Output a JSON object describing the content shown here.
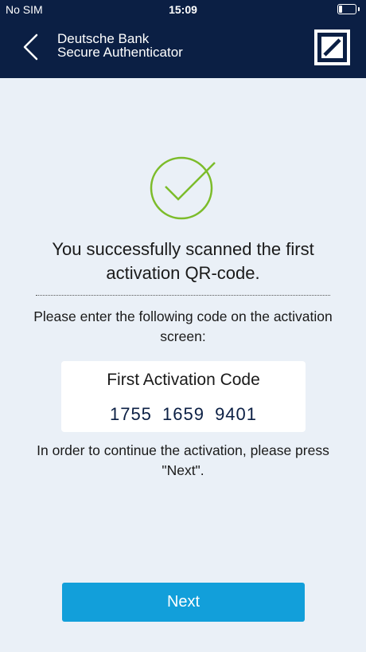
{
  "status_bar": {
    "carrier": "No SIM",
    "time": "15:09"
  },
  "nav": {
    "title_line1": "Deutsche Bank",
    "title_line2": "Secure Authenticator"
  },
  "colors": {
    "header_bg": "#0b1f44",
    "page_bg": "#eaf0f7",
    "success_green": "#7cbc2a",
    "button_blue": "#129fda"
  },
  "icons": {
    "back": "chevron-left-icon",
    "logo": "deutsche-bank-logo",
    "success": "checkmark-circle-icon",
    "battery": "battery-icon"
  },
  "main": {
    "success_message": "You successfully scanned the first activation QR-code.",
    "instruction": "Please enter the following code on the activation screen:",
    "code_card": {
      "label": "First Activation Code",
      "code": "1755 1659 9401"
    },
    "continue_text": "In order to continue the activation, please press \"Next\"."
  },
  "actions": {
    "next_label": "Next"
  }
}
